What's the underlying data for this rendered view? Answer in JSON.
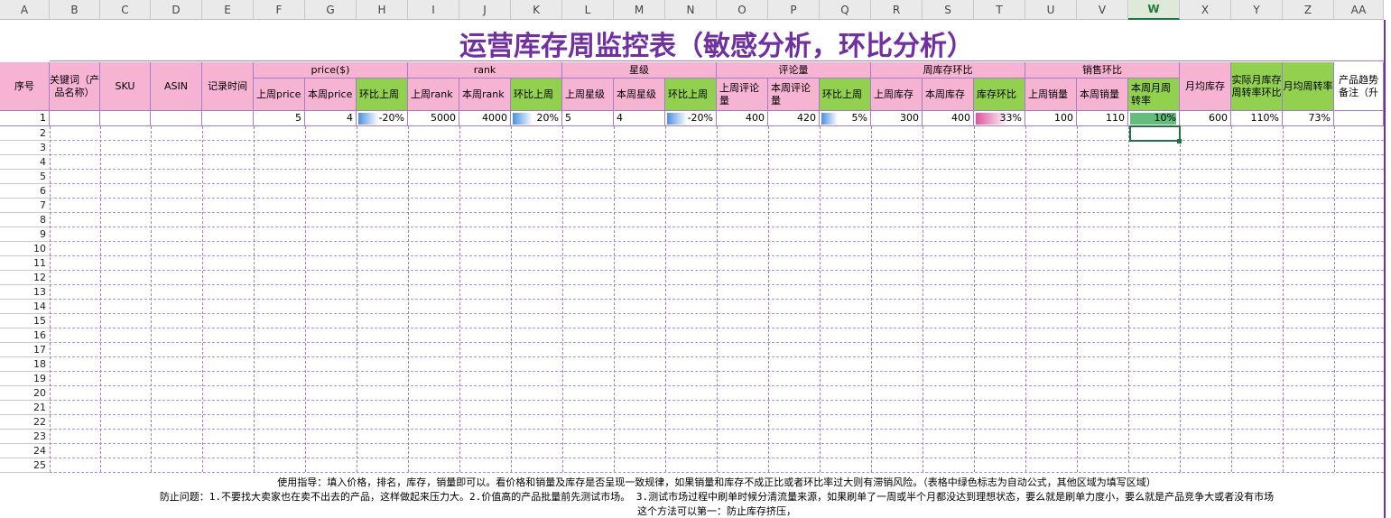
{
  "columns": [
    "A",
    "B",
    "C",
    "D",
    "E",
    "F",
    "G",
    "H",
    "I",
    "J",
    "K",
    "L",
    "M",
    "N",
    "O",
    "P",
    "Q",
    "R",
    "S",
    "T",
    "U",
    "V",
    "W",
    "X",
    "Y",
    "Z",
    "AA"
  ],
  "selected_column": "W",
  "title": "运营库存周监控表（敏感分析，环比分析）",
  "headers": {
    "seq": "序号",
    "keyword": "关键词（产品名称）",
    "sku": "SKU",
    "asin": "ASIN",
    "record_time": "记录时间",
    "groups": {
      "price": "price($)",
      "rank": "rank",
      "star": "星级",
      "reviews": "评论量",
      "stock": "周库存环比",
      "sales": "销售环比"
    },
    "sub": {
      "last_price": "上周price",
      "this_price": "本周price",
      "price_mom": "环比上周",
      "last_rank": "上周rank",
      "this_rank": "本周rank",
      "rank_mom": "环比上周",
      "last_star": "上周星级",
      "this_star": "本周星级",
      "star_mom": "环比上周",
      "last_reviews": "上周评论量",
      "this_reviews": "本周评论量",
      "reviews_mom": "环比上周",
      "last_stock": "上周库存",
      "this_stock": "本周库存",
      "stock_mom": "库存环比",
      "last_sales": "上周销量",
      "this_sales": "本周销量",
      "week_turnover": "本周月周转率"
    },
    "monthly_stock": "月均库存",
    "actual_turnover": "实际月库存周转率环比",
    "monthly_turnover": "月均周转率",
    "trend_note": "产品趋势备注（升"
  },
  "row1": {
    "seq": "1",
    "last_price": "5",
    "this_price": "4",
    "price_mom": "-20%",
    "last_rank": "5000",
    "this_rank": "4000",
    "rank_mom": "20%",
    "last_star": "5",
    "this_star": "4",
    "star_mom": "-20%",
    "last_reviews": "400",
    "this_reviews": "420",
    "reviews_mom": "5%",
    "last_stock": "300",
    "this_stock": "400",
    "stock_mom": "33%",
    "last_sales": "100",
    "this_sales": "110",
    "week_turnover": "10%",
    "monthly_stock": "600",
    "actual_turnover": "110%",
    "monthly_turnover": "73%"
  },
  "databars": {
    "price_mom": 0.2,
    "rank_mom": 0.2,
    "star_mom": 0.2,
    "reviews_mom": 0.05,
    "stock_mom": 0.33,
    "week_turnover": 0.1
  },
  "row_numbers": [
    "2",
    "3",
    "4",
    "5",
    "6",
    "7",
    "8",
    "9",
    "10",
    "11",
    "12",
    "13",
    "14",
    "15",
    "16",
    "17",
    "18",
    "19",
    "20",
    "21",
    "22",
    "23",
    "24",
    "25"
  ],
  "notes": [
    "使用指导：填入价格，排名，库存，销量即可以。看价格和销量及库存是否呈现一致规律，如果销量和库存不成正比或者环比率过大则有滞销风险。（表格中绿色标志为自动公式，其他区域为填写区域）",
    "防止问题：1.不要找大卖家也在卖不出去的产品，这样做起来压力大。2.价值高的产品批量前先测试市场。   3.测试市场过程中刷单时候分清流量来源，如果刷单了一周或半个月都没达到理想状态，要么就是刷单力度小，要么就是产品竞争大或者没有市场",
    "这个方法可以第一：防止库存挤压，"
  ],
  "colors": {
    "pink": "#f7b3d2",
    "green": "#92d050",
    "title": "#7030a0",
    "databar_blue": "#4a90e2",
    "databar_pink": "#e0529c",
    "turnover_fill": "#63be7b"
  }
}
